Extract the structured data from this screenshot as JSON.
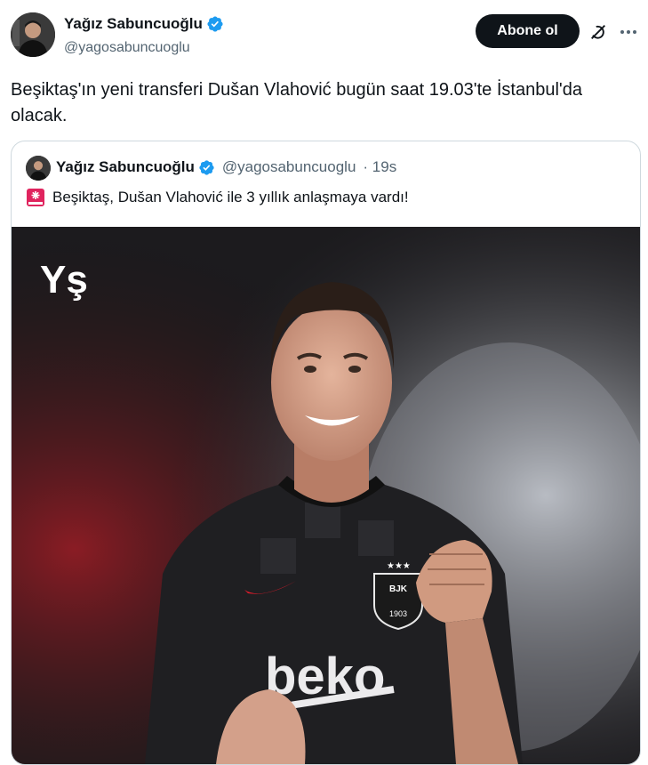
{
  "author": {
    "name": "Yağız Sabuncuoğlu",
    "handle": "@yagosabuncuoglu"
  },
  "follow_label": "Abone ol",
  "tweet_text": "Beşiktaş'ın yeni transferi Dušan Vlahović bugün saat 19.03'te İstanbul'da olacak.",
  "quoted": {
    "name": "Yağız Sabuncuoğlu",
    "handle": "@yagosabuncuoglu",
    "time": "· 19s",
    "text": "Beşiktaş, Dušan Vlahović ile 3 yıllık anlaşmaya vardı!",
    "image": {
      "watermark": "Yş",
      "jersey_sponsor": "beko",
      "crest_text": "BJK",
      "crest_year": "1903"
    }
  },
  "colors": {
    "verified": "#1d9bf0",
    "follow_bg": "#0f1419",
    "handle": "#536471",
    "border": "#cfd9de"
  },
  "icons": {
    "verified": "verified-badge-icon",
    "grok": "grok-icon",
    "more": "more-icon",
    "siren": "siren-icon"
  }
}
